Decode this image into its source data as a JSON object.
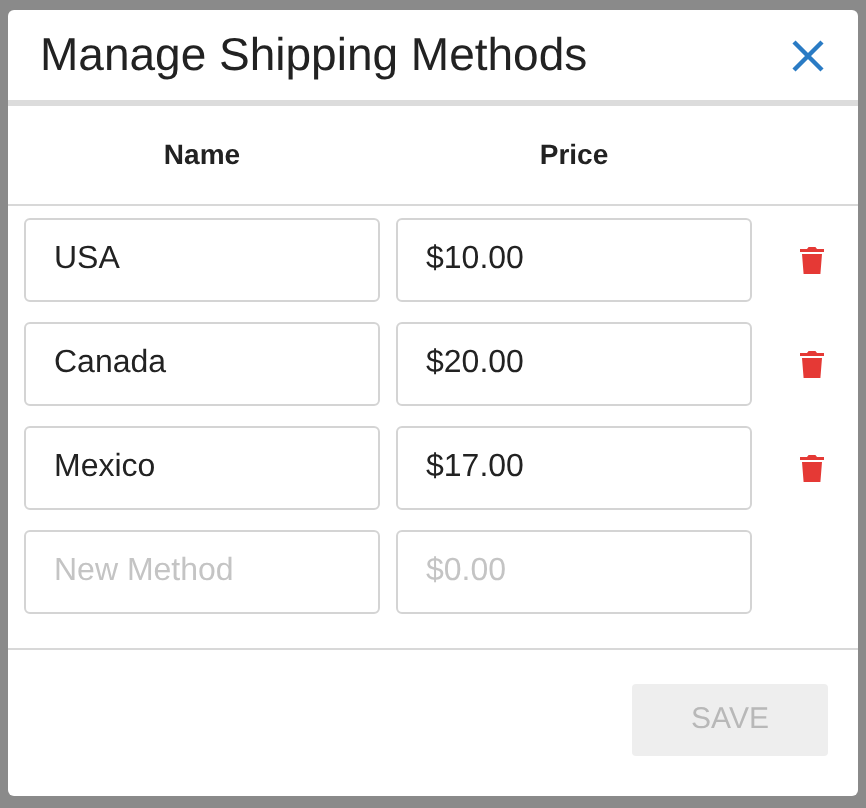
{
  "dialog": {
    "title": "Manage Shipping Methods"
  },
  "columns": [
    "Name",
    "Price"
  ],
  "methods": [
    {
      "name": "USA",
      "price": "$10.00"
    },
    {
      "name": "Canada",
      "price": "$20.00"
    },
    {
      "name": "Mexico",
      "price": "$17.00"
    }
  ],
  "new_method": {
    "name_placeholder": "New Method",
    "price_placeholder": "$0.00"
  },
  "save_button": {
    "label": "SAVE",
    "disabled": true
  }
}
